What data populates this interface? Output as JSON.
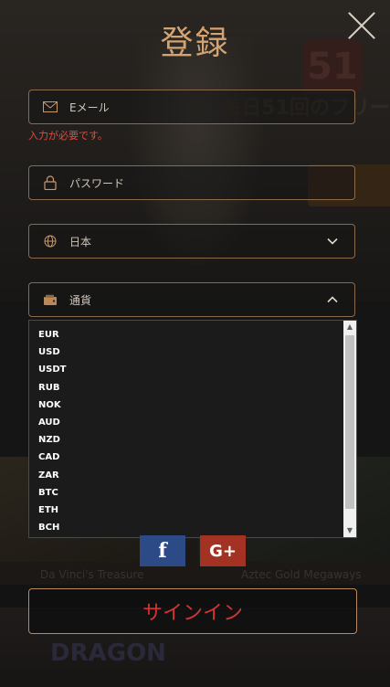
{
  "modal": {
    "title": "登録",
    "close_icon": "close-icon"
  },
  "form": {
    "email": {
      "placeholder": "Eメール",
      "icon": "envelope-icon",
      "error": "入力が必要です。"
    },
    "password": {
      "placeholder": "パスワード",
      "icon": "lock-icon"
    },
    "country": {
      "value": "日本",
      "icon": "globe-icon",
      "chevron": "chevron-down-icon"
    },
    "currency": {
      "label": "通貨",
      "icon": "wallet-icon",
      "chevron": "chevron-up-icon",
      "options": [
        "EUR",
        "USD",
        "USDT",
        "RUB",
        "NOK",
        "AUD",
        "NZD",
        "CAD",
        "ZAR",
        "BTC",
        "ETH",
        "BCH"
      ]
    }
  },
  "social": {
    "facebook": "f",
    "google": "G+"
  },
  "signin_label": "サインイン",
  "background": {
    "promo_text": "毎日51回のフリー",
    "promo_number": "51",
    "games": [
      "Da Vinci's Treasure",
      "Aztec Gold Megaways"
    ],
    "dragon_title": "DRAGON"
  },
  "colors": {
    "accent": "#d4a372",
    "field_border": "#8a6b4c",
    "error": "#e34b3c",
    "signin_text": "#d23434",
    "facebook": "#2b4a86",
    "google": "#a33222"
  }
}
